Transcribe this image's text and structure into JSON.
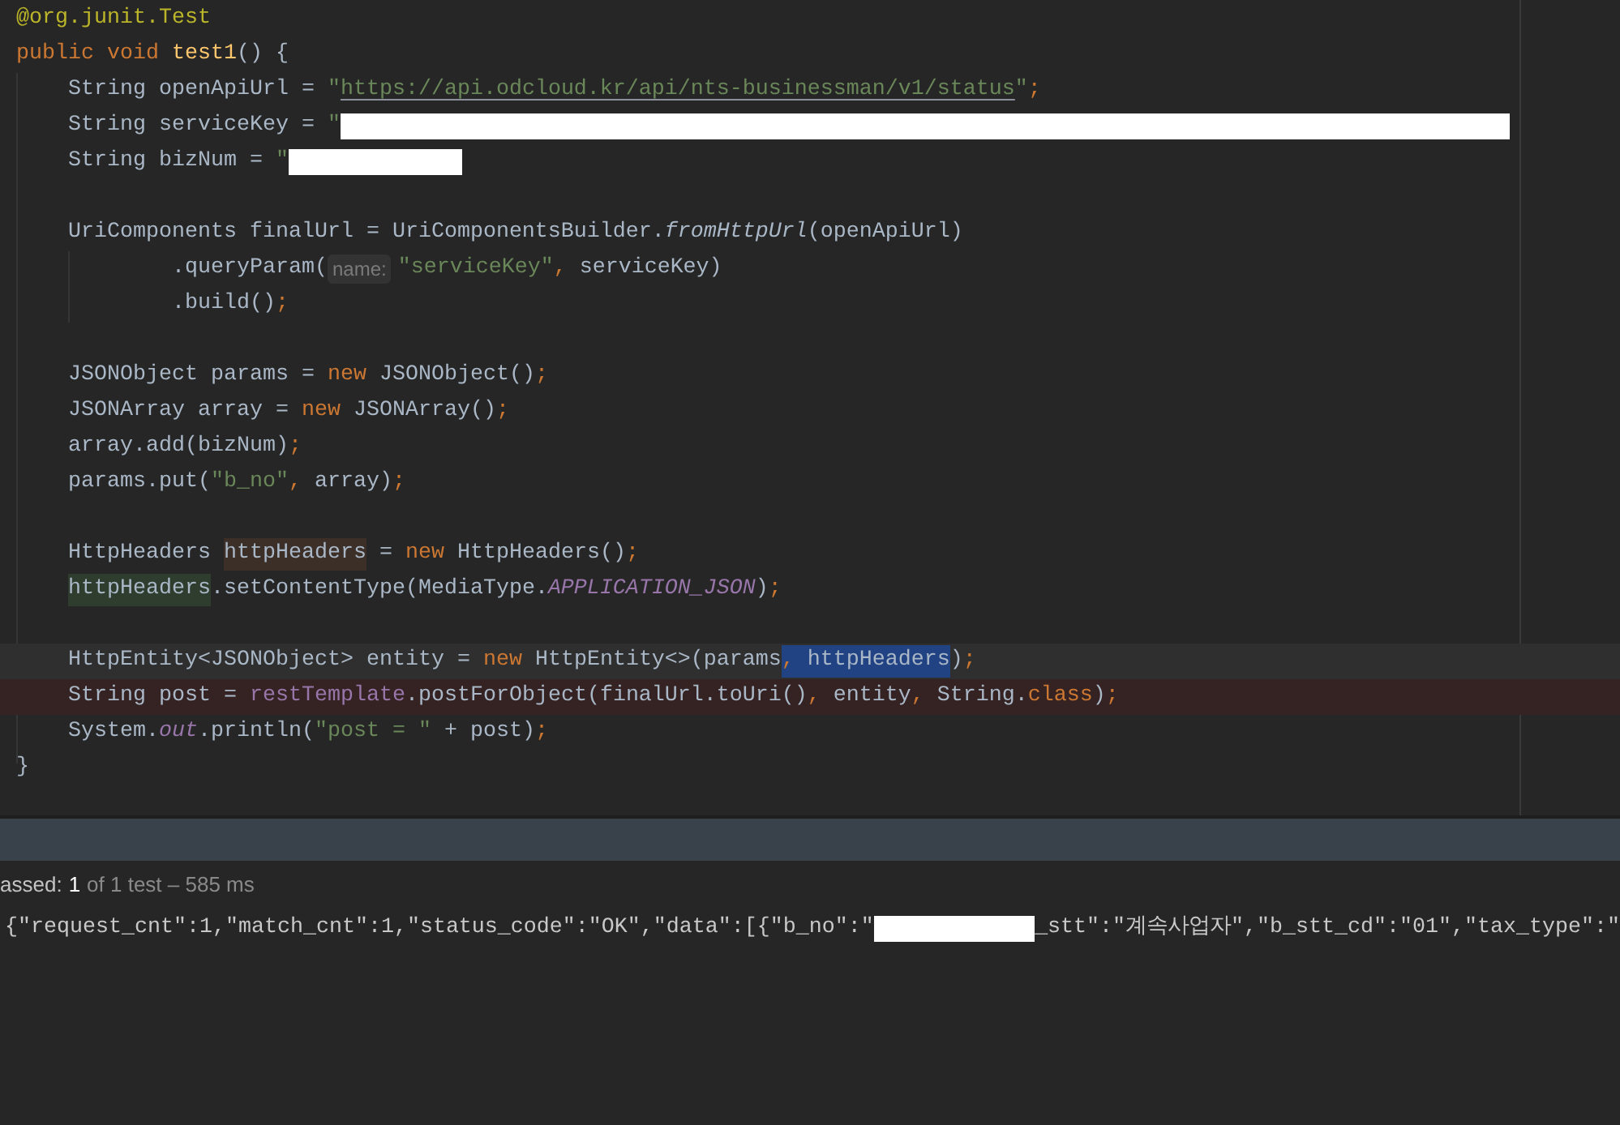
{
  "editor": {
    "lines": [
      {
        "kind": "top",
        "tokens": [
          {
            "t": "@org.junit.",
            "kind": "annotation"
          },
          {
            "t": "Test",
            "kind": "annotation"
          }
        ]
      },
      {
        "kind": "top",
        "tokens": [
          {
            "t": "public void ",
            "kind": "keyword"
          },
          {
            "t": "test1",
            "kind": "method_decl"
          },
          {
            "t": "() {",
            "kind": "plain"
          }
        ]
      },
      {
        "kind": "body",
        "tokens": [
          {
            "t": "String openApiUrl = ",
            "kind": "plain"
          },
          {
            "t": "\"",
            "kind": "string"
          },
          {
            "t": "https://api.odcloud.kr/api/nts-businessman/v1/status",
            "kind": "link"
          },
          {
            "t": "\"",
            "kind": "string"
          },
          {
            "t": ";",
            "kind": "punct"
          }
        ]
      },
      {
        "kind": "body",
        "tokens": [
          {
            "t": "String serviceKey = ",
            "kind": "plain"
          },
          {
            "t": "\"",
            "kind": "string"
          },
          {
            "kind": "redacted"
          }
        ]
      },
      {
        "kind": "body",
        "tokens": [
          {
            "t": "String bizNum = ",
            "kind": "plain"
          },
          {
            "t": "\"",
            "kind": "string"
          },
          {
            "kind": "redacted"
          }
        ]
      },
      {
        "kind": "blank"
      },
      {
        "kind": "body",
        "tokens": [
          {
            "t": "UriComponents finalUrl = UriComponentsBuilder.",
            "kind": "plain"
          },
          {
            "t": "fromHttpUrl",
            "kind": "italic"
          },
          {
            "t": "(openApiUrl)",
            "kind": "plain"
          }
        ]
      },
      {
        "kind": "continuation",
        "tokens": [
          {
            "t": ".queryParam(",
            "kind": "plain"
          },
          {
            "t": "name:",
            "kind": "hint"
          },
          {
            "t": "\"serviceKey\"",
            "kind": "string"
          },
          {
            "t": ",",
            "kind": "punct"
          },
          {
            "t": " serviceKey)",
            "kind": "plain"
          }
        ]
      },
      {
        "kind": "continuation",
        "tokens": [
          {
            "t": ".build()",
            "kind": "plain"
          },
          {
            "t": ";",
            "kind": "punct"
          }
        ]
      },
      {
        "kind": "blank"
      },
      {
        "kind": "body",
        "tokens": [
          {
            "t": "JSONObject params = ",
            "kind": "plain"
          },
          {
            "t": "new ",
            "kind": "keyword"
          },
          {
            "t": "JSONObject()",
            "kind": "plain"
          },
          {
            "t": ";",
            "kind": "punct"
          }
        ]
      },
      {
        "kind": "body",
        "tokens": [
          {
            "t": "JSONArray array = ",
            "kind": "plain"
          },
          {
            "t": "new ",
            "kind": "keyword"
          },
          {
            "t": "JSONArray()",
            "kind": "plain"
          },
          {
            "t": ";",
            "kind": "punct"
          }
        ]
      },
      {
        "kind": "body",
        "tokens": [
          {
            "t": "array.add(bizNum)",
            "kind": "plain"
          },
          {
            "t": ";",
            "kind": "punct"
          }
        ]
      },
      {
        "kind": "body",
        "tokens": [
          {
            "t": "params.put(",
            "kind": "plain"
          },
          {
            "t": "\"b_no\"",
            "kind": "string"
          },
          {
            "t": ",",
            "kind": "punct"
          },
          {
            "t": " array)",
            "kind": "plain"
          },
          {
            "t": ";",
            "kind": "punct"
          }
        ]
      },
      {
        "kind": "blank"
      },
      {
        "kind": "body",
        "tokens": [
          {
            "t": "HttpHeaders ",
            "kind": "plain"
          },
          {
            "t": "httpHeaders",
            "kind": "read_usage"
          },
          {
            "t": " = ",
            "kind": "plain"
          },
          {
            "t": "new ",
            "kind": "keyword"
          },
          {
            "t": "HttpHeaders()",
            "kind": "plain"
          },
          {
            "t": ";",
            "kind": "punct"
          }
        ]
      },
      {
        "kind": "body",
        "tokens": [
          {
            "t": "httpHeaders",
            "kind": "write_usage"
          },
          {
            "t": ".setContentType(MediaType.",
            "kind": "plain"
          },
          {
            "t": "APPLICATION_JSON",
            "kind": "constant"
          },
          {
            "t": ")",
            "kind": "plain"
          },
          {
            "t": ";",
            "kind": "punct"
          }
        ]
      },
      {
        "kind": "blank"
      },
      {
        "kind": "body",
        "current": true,
        "tokens": [
          {
            "t": "HttpEntity<JSONObject> entity = ",
            "kind": "plain"
          },
          {
            "t": "new ",
            "kind": "keyword"
          },
          {
            "t": "HttpEntity<>(params",
            "kind": "plain"
          },
          {
            "t": ",",
            "kind": "selected_punct"
          },
          {
            "t": " httpHeaders",
            "kind": "selected"
          },
          {
            "t": ")",
            "kind": "plain"
          },
          {
            "t": ";",
            "kind": "punct"
          }
        ]
      },
      {
        "kind": "body",
        "error": true,
        "tokens": [
          {
            "t": "String post = ",
            "kind": "plain"
          },
          {
            "t": "restTemplate",
            "kind": "field"
          },
          {
            "t": ".postForObject(finalUrl.toUri()",
            "kind": "plain"
          },
          {
            "t": ",",
            "kind": "punct"
          },
          {
            "t": " entity",
            "kind": "plain"
          },
          {
            "t": ",",
            "kind": "punct"
          },
          {
            "t": " String.",
            "kind": "plain"
          },
          {
            "t": "class",
            "kind": "keyword"
          },
          {
            "t": ")",
            "kind": "plain"
          },
          {
            "t": ";",
            "kind": "punct"
          }
        ]
      },
      {
        "kind": "body",
        "tokens": [
          {
            "t": "System.",
            "kind": "plain"
          },
          {
            "t": "out",
            "kind": "static_field"
          },
          {
            "t": ".println(",
            "kind": "plain"
          },
          {
            "t": "\"post = \"",
            "kind": "string"
          },
          {
            "t": " + post)",
            "kind": "plain"
          },
          {
            "t": ";",
            "kind": "punct"
          }
        ]
      },
      {
        "kind": "top",
        "tokens": [
          {
            "t": "}",
            "kind": "plain"
          }
        ]
      }
    ]
  },
  "test_status": {
    "label": "assed:",
    "count": "1",
    "detail": "of 1 test – 585 ms"
  },
  "console": {
    "segments": [
      {
        "t": "{\"request_cnt\":1,\"match_cnt\":1,\"status_code\":\"OK\",\"data\":[{\"b_no\":\"",
        "kind": "text"
      },
      {
        "kind": "redacted"
      },
      {
        "t": "_stt\":\"계속사업자\",\"b_stt_cd\":\"01\",\"tax_type\":\"",
        "kind": "text"
      }
    ]
  }
}
